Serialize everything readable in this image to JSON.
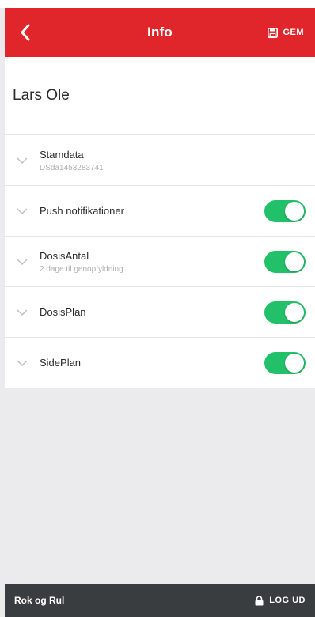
{
  "header": {
    "title": "Info",
    "back_icon": "chevron-left-icon",
    "save_icon": "floppy-disk-icon",
    "save_label": "GEM",
    "accent_color": "#e0262b"
  },
  "profile": {
    "name": "Lars Ole"
  },
  "rows": [
    {
      "title": "Stamdata",
      "subtitle": "DSda1453283741",
      "has_toggle": false
    },
    {
      "title": "Push notifikationer",
      "subtitle": "",
      "has_toggle": true,
      "toggle_on": true
    },
    {
      "title": "DosisAntal",
      "subtitle": "2 dage til genopfyldning",
      "has_toggle": true,
      "toggle_on": true
    },
    {
      "title": "DosisPlan",
      "subtitle": "",
      "has_toggle": true,
      "toggle_on": true
    },
    {
      "title": "SidePlan",
      "subtitle": "",
      "has_toggle": true,
      "toggle_on": true
    }
  ],
  "footer": {
    "app_name": "Rok og Rul",
    "logout_icon": "lock-icon",
    "logout_label": "LOG UD"
  },
  "colors": {
    "toggle_on": "#22c069",
    "footer_bg": "#3a3d40"
  }
}
